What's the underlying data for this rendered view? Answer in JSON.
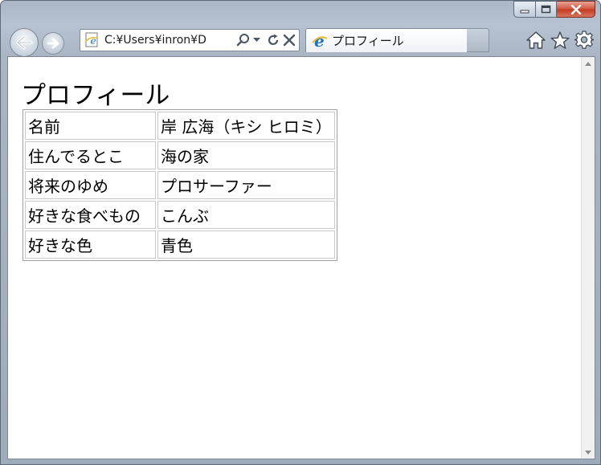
{
  "browser": {
    "address": "C:¥Users¥inron¥D",
    "tab_title": "プロフィール",
    "icons": {
      "back": "back-arrow-icon",
      "forward": "forward-arrow-icon",
      "search": "search-icon",
      "refresh": "refresh-icon",
      "stop": "stop-icon",
      "home": "home-icon",
      "favorites": "star-icon",
      "tools": "gear-icon"
    },
    "colors": {
      "frame": "#a9b5c3",
      "close_button": "#c43a22",
      "ie_logo": "#1e73be"
    }
  },
  "page": {
    "title": "プロフィール",
    "rows": [
      {
        "key": "名前",
        "value": "岸 広海（キシ ヒロミ）"
      },
      {
        "key": "住んでるとこ",
        "value": "海の家"
      },
      {
        "key": "将来のゆめ",
        "value": "プロサーファー"
      },
      {
        "key": "好きな食べもの",
        "value": "こんぶ"
      },
      {
        "key": "好きな色",
        "value": "青色"
      }
    ]
  }
}
